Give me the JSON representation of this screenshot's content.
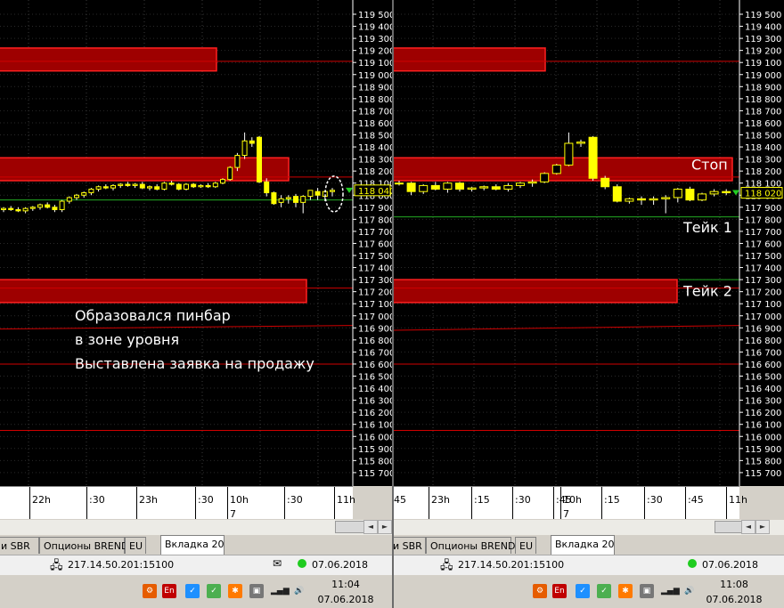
{
  "left": {
    "annotation": [
      "Образовался пинбар",
      "в зоне уровня",
      "Выставлена заявка на продажу"
    ],
    "current_price": "118 040",
    "time_labels": [
      "22h",
      ":30",
      "23h",
      ":30",
      "10h",
      ":30",
      "11h"
    ],
    "day_label": "7",
    "tabs": [
      "и SBR",
      "Опционы BREND",
      "EU",
      "Вкладка 20"
    ],
    "server": "217.14.50.201:15100",
    "date": "07.06.2018",
    "clock_time": "11:04",
    "clock_date": "07.06.2018"
  },
  "right": {
    "labels": {
      "stop": "Стоп",
      "take1": "Тейк 1",
      "take2": "Тейк 2"
    },
    "current_price": "118 020",
    "time_labels": [
      "45",
      "23h",
      ":15",
      ":30",
      ":45",
      "10h",
      ":15",
      ":30",
      ":45",
      "11h"
    ],
    "day_label": "7",
    "tabs": [
      "и SBR",
      "Опционы BREND",
      "EU",
      "Вкладка 20"
    ],
    "server": "217.14.50.201:15100",
    "date": "07.06.2018",
    "clock_time": "11:08",
    "clock_date": "07.06.2018"
  },
  "price_axis": [
    "119 500",
    "119 400",
    "119 300",
    "119 200",
    "119 100",
    "119 000",
    "118 900",
    "118 800",
    "118 700",
    "118 600",
    "118 500",
    "118 400",
    "118 300",
    "118 200",
    "118 100",
    "118 000",
    "117 900",
    "117 800",
    "117 700",
    "117 600",
    "117 500",
    "117 400",
    "117 300",
    "117 200",
    "117 100",
    "117 000",
    "116 900",
    "116 800",
    "116 700",
    "116 600",
    "116 500",
    "116 400",
    "116 300",
    "116 200",
    "116 100",
    "116 000",
    "115 900",
    "115 800",
    "115 700"
  ],
  "taskbar": {
    "lang": "En"
  },
  "colors": {
    "bull": "#ffff00",
    "bear": "#ffff00",
    "zone_fill": "#9e0000",
    "zone_border": "#ff2020",
    "level_line": "#d00000",
    "green_line": "#22aa22"
  }
}
